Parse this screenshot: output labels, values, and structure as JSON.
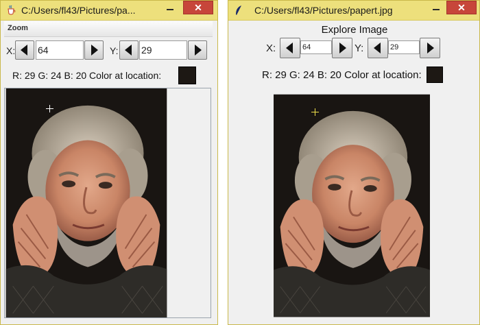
{
  "windows": {
    "zoom": {
      "title": "C:/Users/fl43/Pictures/pa...",
      "menu": "Zoom",
      "x_label": "X:",
      "x_value": "64",
      "y_label": "Y:",
      "y_value": "29",
      "color_info": "R: 29 G: 24 B: 20 Color at location:",
      "close_label": "✕"
    },
    "explore": {
      "title": "C:/Users/fl43/Pictures/papert.jpg",
      "heading": "Explore Image",
      "x_label": "X:",
      "x_value": "64",
      "y_label": "Y:",
      "y_value": "29",
      "color_info": "R: 29 G: 24 B: 20 Color at location:",
      "close_label": "✕"
    }
  },
  "colors": {
    "swatch": "#1d1814",
    "crosshair_zoom": "#ffffff",
    "crosshair_explore": "#f0e04a",
    "titlebar": "#ede07c",
    "close": "#c7463a"
  },
  "icons": {
    "zoom_window": "java-cup-icon",
    "explore_window": "feather-icon"
  }
}
